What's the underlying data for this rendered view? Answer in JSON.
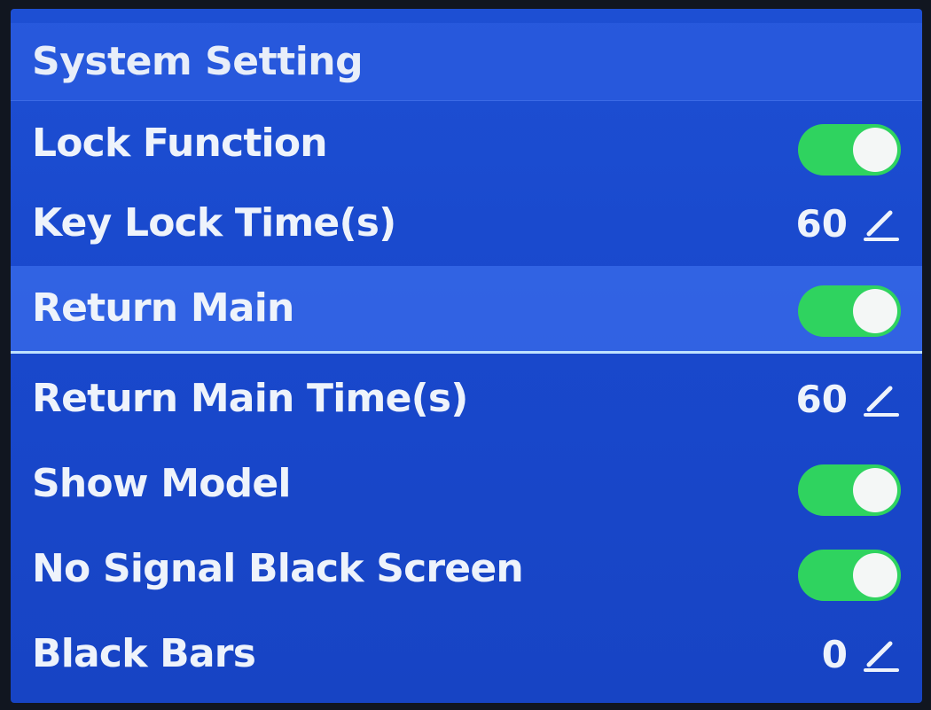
{
  "title": "System Setting",
  "rows": [
    {
      "label": "Lock Function",
      "type": "toggle",
      "on": true
    },
    {
      "label": "Key Lock Time(s)",
      "type": "value",
      "value": "60",
      "icon": "edit-pencil-icon"
    },
    {
      "label": "Return Main",
      "type": "toggle",
      "on": true,
      "selected": true
    },
    {
      "label": "Return Main Time(s)",
      "type": "value",
      "value": "60",
      "icon": "edit-pencil-icon"
    },
    {
      "label": "Show Model",
      "type": "toggle",
      "on": true
    },
    {
      "label": "No Signal Black Screen",
      "type": "toggle",
      "on": true
    },
    {
      "label": "Black Bars",
      "type": "value",
      "value": "0",
      "icon": "edit-pencil-icon"
    }
  ],
  "colors": {
    "background": "#1948cc",
    "toggle_on": "#2fd35f",
    "text": "#eef3fb",
    "selection_line": "#bfe2ff"
  }
}
